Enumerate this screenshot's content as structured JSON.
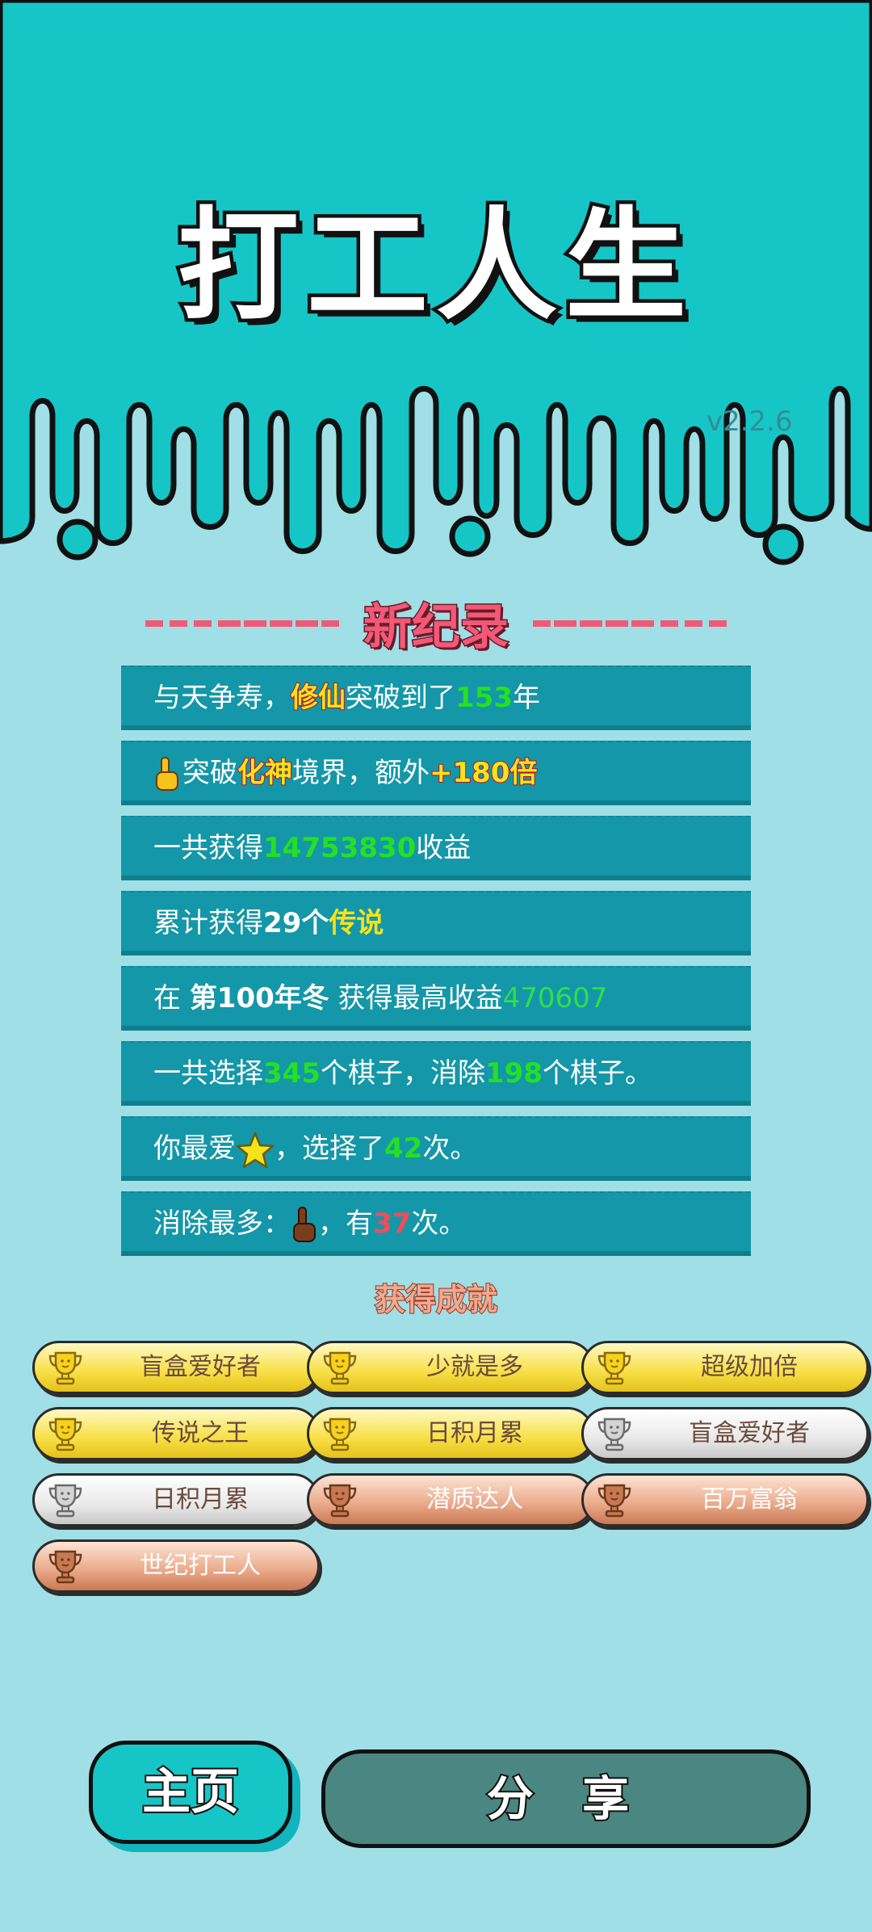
{
  "game": {
    "title": "打工人生",
    "version": "v2.2.6"
  },
  "record": {
    "header": "新纪录",
    "rows": [
      {
        "parts": [
          "与天争寿，",
          "修仙",
          "突破到了",
          "153",
          "年"
        ]
      },
      {
        "parts": [
          "突破",
          "化神",
          "境界，额外",
          "+180倍"
        ]
      },
      {
        "parts": [
          "一共获得",
          "14753830",
          "收益"
        ]
      },
      {
        "parts": [
          "累计获得",
          "29个",
          "传说"
        ]
      },
      {
        "parts": [
          "在 ",
          "第100年冬",
          " 获得最高收益",
          "470607"
        ]
      },
      {
        "parts": [
          "一共选择",
          "345",
          "个棋子，消除",
          "198",
          "个棋子。"
        ]
      },
      {
        "parts": [
          "你最爱",
          "，选择了",
          "42",
          "次。"
        ]
      },
      {
        "parts": [
          "消除最多：",
          "，有",
          "37",
          "次。"
        ]
      }
    ]
  },
  "achievements": {
    "title": "获得成就",
    "items": [
      {
        "label": "盲盒爱好者",
        "tier": "gold"
      },
      {
        "label": "少就是多",
        "tier": "gold"
      },
      {
        "label": "超级加倍",
        "tier": "gold"
      },
      {
        "label": "传说之王",
        "tier": "gold"
      },
      {
        "label": "日积月累",
        "tier": "gold"
      },
      {
        "label": "盲盒爱好者",
        "tier": "silver"
      },
      {
        "label": "日积月累",
        "tier": "silver"
      },
      {
        "label": "潜质达人",
        "tier": "bronze"
      },
      {
        "label": "百万富翁",
        "tier": "bronze"
      },
      {
        "label": "世纪打工人",
        "tier": "bronze"
      }
    ]
  },
  "buttons": {
    "home": "主页",
    "share": "分 享"
  },
  "colors": {
    "top_bg": "#16c6c7",
    "page_bg": "#a0dfe6",
    "row_bg": "#1497a8",
    "highlight_green": "#24e024",
    "highlight_yellow": "#f7e21b",
    "record_pink": "#f25977"
  },
  "icons": [
    "pointing-hand-icon",
    "star-icon",
    "trophy-icon"
  ]
}
